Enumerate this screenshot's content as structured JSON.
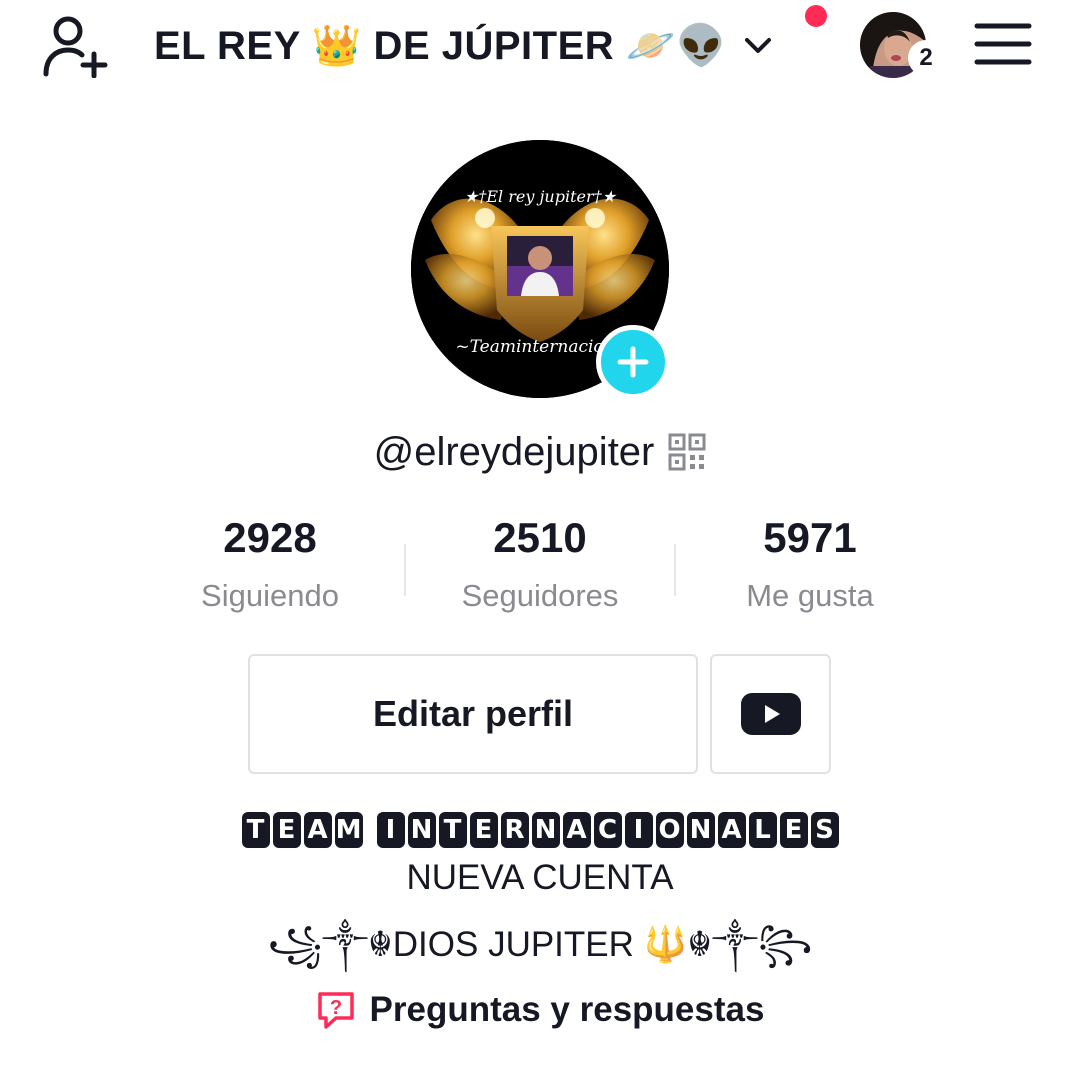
{
  "header": {
    "title": "EL REY 👑 DE JÚPITER 🪐👽",
    "notification_count": "2",
    "icons": [
      "add-user-icon",
      "chevron-down-icon",
      "hamburger-menu-icon"
    ],
    "notification_dot_color": "#fe2c55"
  },
  "profile": {
    "handle": "@elreydejupiter",
    "add_button_color": "#20d5ec",
    "avatar_text_top": "★†El rey jupiter†★",
    "avatar_text_bottom": "~Teaminternacion"
  },
  "stats": [
    {
      "value": "2928",
      "label": "Siguiendo"
    },
    {
      "value": "2510",
      "label": "Seguidores"
    },
    {
      "value": "5971",
      "label": "Me gusta"
    }
  ],
  "actions": {
    "edit_label": "Editar perfil",
    "youtube_icon": "youtube-icon"
  },
  "bio": {
    "team_words": [
      "TEAM",
      "INTERNACIONALES"
    ],
    "line2": "NUEVA CUENTA",
    "line3": "꧁༒☬DIOS JUPITER 🔱☬༒꧂",
    "qa_label": "Preguntas y respuestas"
  }
}
